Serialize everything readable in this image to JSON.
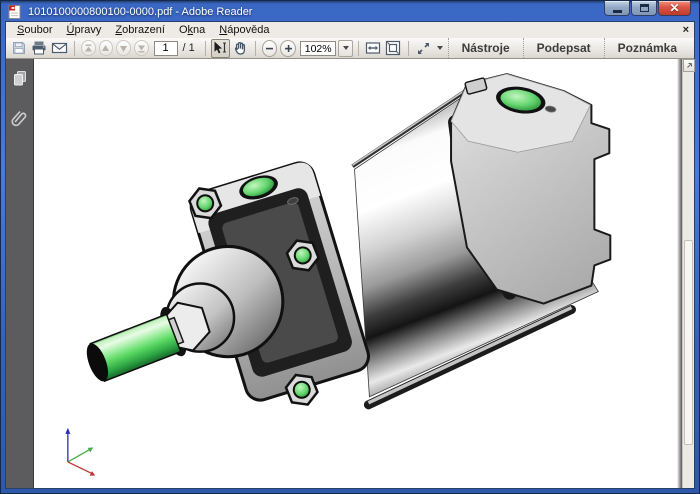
{
  "window": {
    "title": "1010100000800100-0000.pdf - Adobe Reader",
    "app_icon": "adobe-reader-pdf-icon",
    "controls": [
      "minimize",
      "maximize",
      "close"
    ]
  },
  "menu_bar": {
    "items": [
      {
        "label": "Soubor",
        "mnemonic_index": 0
      },
      {
        "label": "Úpravy",
        "mnemonic_index": 0
      },
      {
        "label": "Zobrazení",
        "mnemonic_index": 0
      },
      {
        "label": "Okna",
        "mnemonic_index": 1
      },
      {
        "label": "Nápověda",
        "mnemonic_index": 0
      }
    ],
    "close_glyph": "×"
  },
  "toolbar": {
    "file_icons": [
      "save-icon",
      "print-icon",
      "email-icon"
    ],
    "nav_icons": [
      "first-page-icon",
      "previous-page-icon",
      "next-page-icon",
      "last-page-icon"
    ],
    "page_number": "1",
    "page_count_label": "/ 1",
    "tool_icons": [
      "select-tool-icon",
      "hand-tool-icon"
    ],
    "zoom_icons": [
      "zoom-out-icon",
      "zoom-in-icon"
    ],
    "zoom_level": "102%",
    "view_icons": [
      "fit-width-icon",
      "fit-page-icon",
      "reading-mode-icon",
      "more-options-chevron"
    ],
    "right_buttons": [
      {
        "label": "Nástroje"
      },
      {
        "label": "Podepsat"
      },
      {
        "label": "Poznámka"
      }
    ]
  },
  "sidebar": {
    "icons": [
      "page-thumbnails-icon",
      "attachments-icon"
    ]
  },
  "document": {
    "content": "3D CAD render of a flange-mounted pneumatic cylinder with green piston rod, green ports and green tie-rod nut centers; coordinate axis triad at lower left",
    "colors": {
      "accent_green": "#5ed36a",
      "metal_light": "#f4f4f4",
      "metal_mid": "#c6c6c6",
      "metal_dark": "#1a1a1a",
      "axis_x_red": "#c03232",
      "axis_y_green": "#43ad43",
      "axis_z_blue": "#2a2ac2",
      "titlebar_blue": "#4a7ada"
    }
  }
}
